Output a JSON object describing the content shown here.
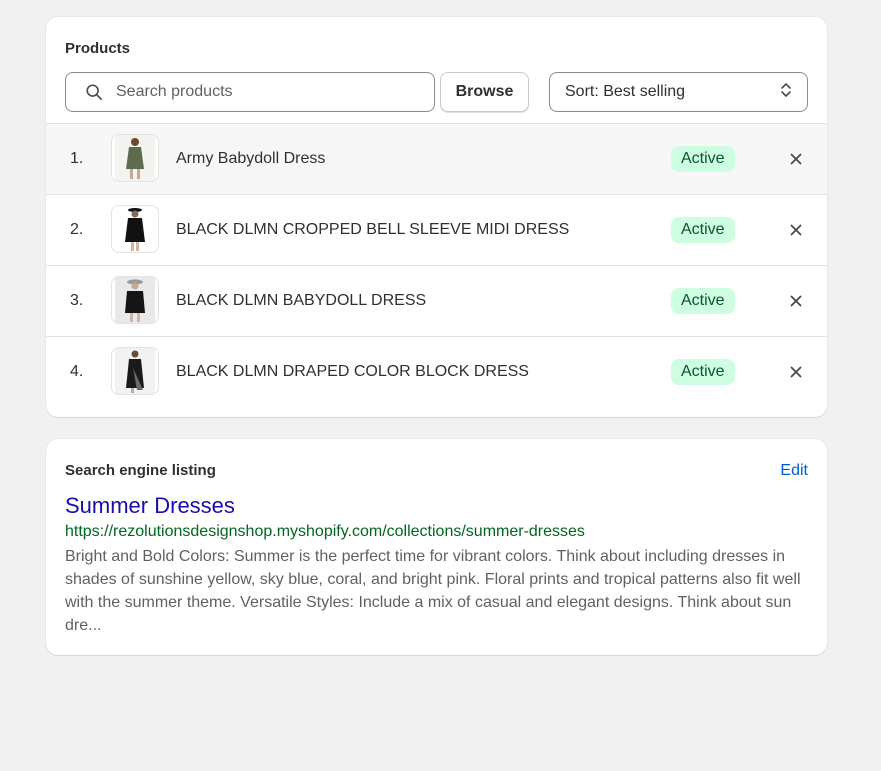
{
  "products": {
    "title": "Products",
    "search_placeholder": "Search products",
    "browse_label": "Browse",
    "sort_label": "Sort: Best selling",
    "items": [
      {
        "index": "1.",
        "name": "Army Babydoll Dress",
        "status": "Active",
        "thumb_color": "#5f6b4e"
      },
      {
        "index": "2.",
        "name": "BLACK DLMN CROPPED BELL SLEEVE MIDI DRESS",
        "status": "Active",
        "thumb_color": "#111111"
      },
      {
        "index": "3.",
        "name": "BLACK DLMN BABYDOLL DRESS",
        "status": "Active",
        "thumb_color": "#151515"
      },
      {
        "index": "4.",
        "name": "BLACK DLMN DRAPED COLOR BLOCK DRESS",
        "status": "Active",
        "thumb_color": "#1a1a1a"
      }
    ]
  },
  "seo": {
    "title": "Search engine listing",
    "edit_label": "Edit",
    "page_title": "Summer Dresses",
    "url": "https://rezolutionsdesignshop.myshopify.com/collections/summer-dresses",
    "description": "Bright and Bold Colors: Summer is the perfect time for vibrant colors. Think about including dresses in shades of sunshine yellow, sky blue, coral, and bright pink. Floral prints and tropical patterns also fit well with the summer theme. Versatile Styles: Include a mix of casual and elegant designs. Think about sun dre..."
  },
  "colors": {
    "badge_bg": "#cdfee1",
    "badge_text": "#0c5132",
    "link_blue": "#005bd3",
    "seo_title": "#1a0dab",
    "seo_url": "#006621"
  },
  "icons": {
    "search": "search-icon",
    "sort": "select-chevrons-icon",
    "remove": "close-icon"
  }
}
